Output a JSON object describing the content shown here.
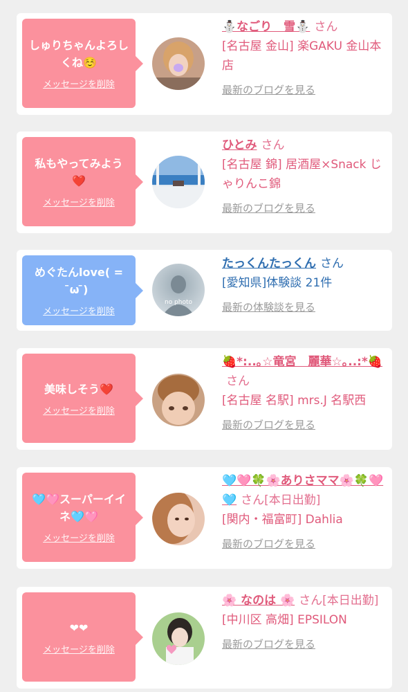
{
  "cards": [
    {
      "message": "しゅりちゃんよろしくね☺️",
      "delete_label": "メッセージを削除",
      "name": "⛄️なごり　雪⛄️",
      "san": "さん",
      "shop": "[名古屋 金山] 楽GAKU 金山本店",
      "link": "最新のブログを見る",
      "theme": "pink",
      "avatar": "user-photo-1"
    },
    {
      "message": "私もやってみよう❤️",
      "delete_label": "メッセージを削除",
      "name": "ひとみ",
      "san": "さん",
      "shop": "[名古屋 錦] 居酒屋×Snack じゃりんこ錦",
      "link": "最新のブログを見る",
      "theme": "pink",
      "avatar": "user-photo-2"
    },
    {
      "message": "めぐたんlove( = ̄ω ̄)",
      "delete_label": "メッセージを削除",
      "name": "たっくんたっくん",
      "san": "さん",
      "shop": "[愛知県]体験談 21件",
      "link": "最新の体験談を見る",
      "theme": "blue",
      "avatar": "no-photo",
      "no_photo_text": "no photo"
    },
    {
      "message": "美味しそう❤️",
      "delete_label": "メッセージを削除",
      "name": "🍓*:..｡☆竜宮　麗華☆｡..:*🍓",
      "san": "さん",
      "shop": "[名古屋 名駅] mrs.J 名駅西",
      "link": "最新のブログを見る",
      "theme": "pink",
      "avatar": "user-photo-4"
    },
    {
      "message": "🩵🩷スーパーイイネ🩵🩷",
      "delete_label": "メッセージを削除",
      "name": "🩵🩷🍀🌸ありさママ🌸🍀🩷🩵",
      "san": "さん[本日出勤]",
      "shop": "[関内・福富町] Dahlia",
      "link": "最新のブログを見る",
      "theme": "pink",
      "avatar": "user-photo-5"
    },
    {
      "message": "❤❤",
      "delete_label": "メッセージを削除",
      "name": "🌸 なのは 🌸",
      "san": "さん[本日出勤]",
      "shop": "[中川区 高畑] EPSILON",
      "link": "最新のブログを見る",
      "theme": "pink",
      "avatar": "user-photo-6"
    }
  ],
  "colors": {
    "bubble_pink": "#fb919d",
    "bubble_blue": "#86b3f7",
    "name_pink": "#e05a7b",
    "name_blue": "#2f6eb0",
    "link_gray": "#9a9a9a"
  }
}
